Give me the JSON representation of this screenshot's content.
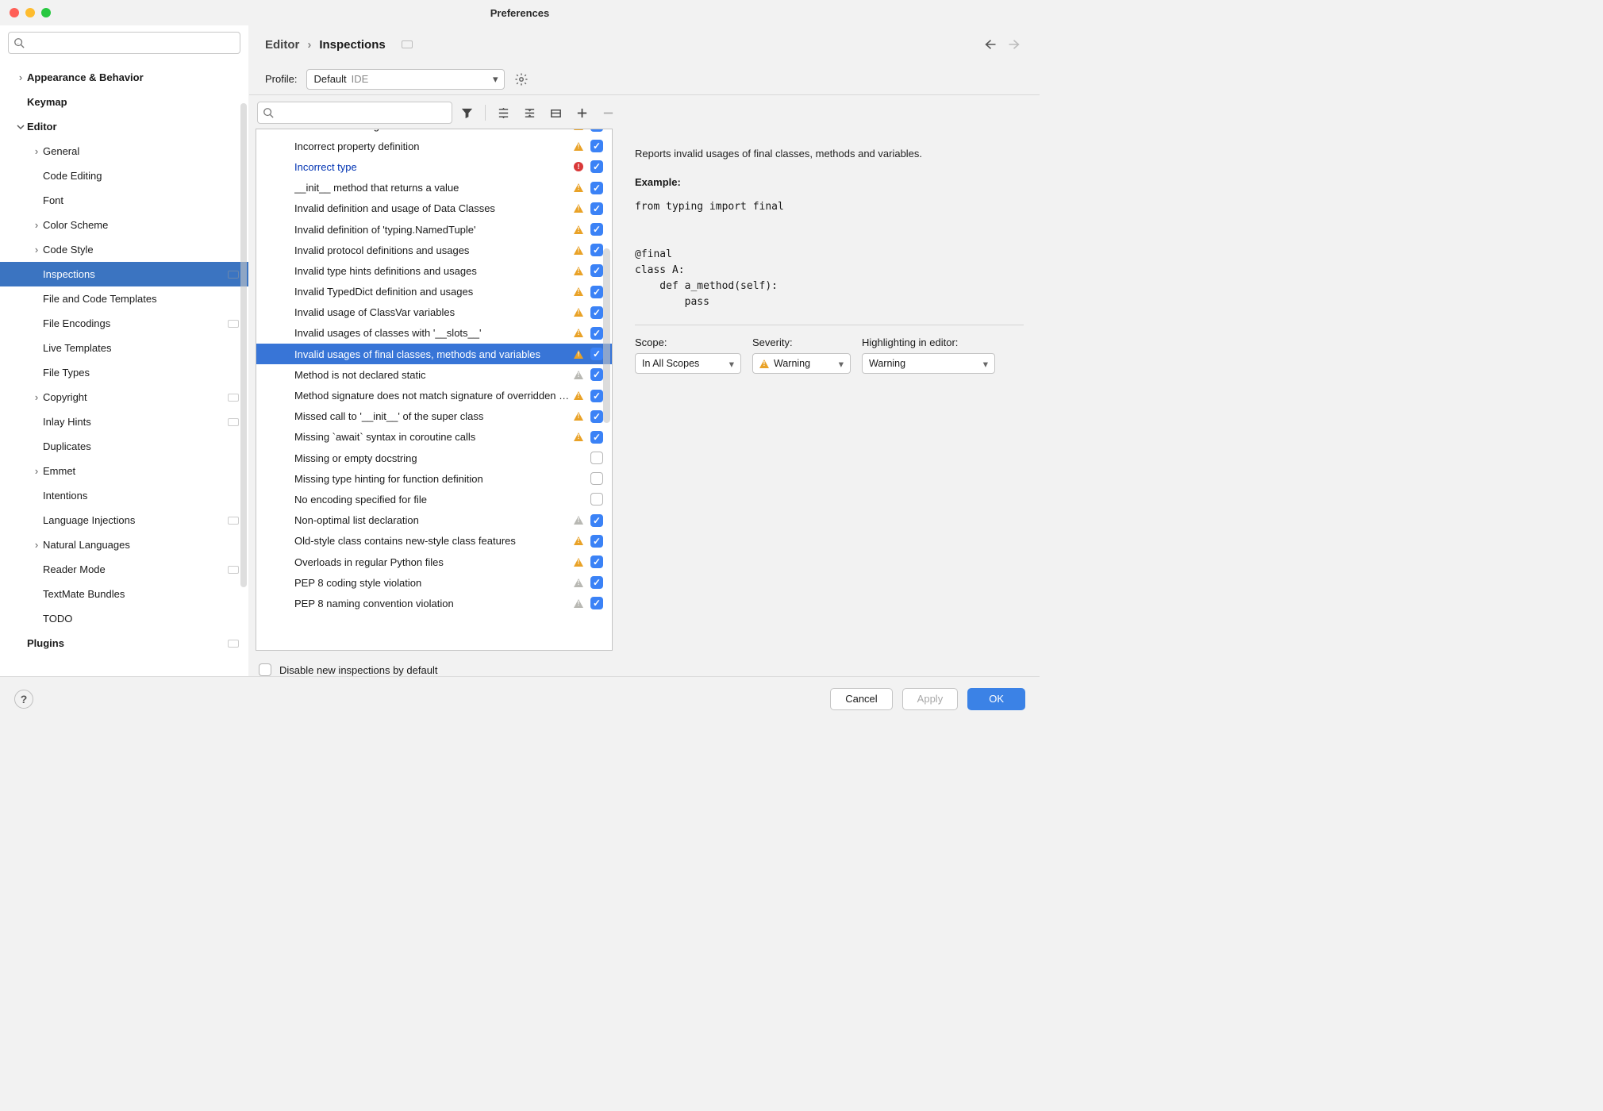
{
  "window": {
    "title": "Preferences"
  },
  "breadcrumb": {
    "parent": "Editor",
    "current": "Inspections"
  },
  "profile": {
    "label": "Profile:",
    "selected": "Default",
    "suffix": "IDE"
  },
  "sidebar": {
    "items": [
      {
        "label": "Appearance & Behavior",
        "level": 0,
        "bold": true,
        "arrow": "right"
      },
      {
        "label": "Keymap",
        "level": 0,
        "bold": true
      },
      {
        "label": "Editor",
        "level": 0,
        "bold": true,
        "arrow": "down"
      },
      {
        "label": "General",
        "level": 1,
        "arrow": "right"
      },
      {
        "label": "Code Editing",
        "level": 1
      },
      {
        "label": "Font",
        "level": 1
      },
      {
        "label": "Color Scheme",
        "level": 1,
        "arrow": "right"
      },
      {
        "label": "Code Style",
        "level": 1,
        "arrow": "right"
      },
      {
        "label": "Inspections",
        "level": 1,
        "selected": true,
        "badge": true
      },
      {
        "label": "File and Code Templates",
        "level": 1
      },
      {
        "label": "File Encodings",
        "level": 1,
        "badge": true
      },
      {
        "label": "Live Templates",
        "level": 1
      },
      {
        "label": "File Types",
        "level": 1
      },
      {
        "label": "Copyright",
        "level": 1,
        "arrow": "right",
        "badge": true
      },
      {
        "label": "Inlay Hints",
        "level": 1,
        "badge": true
      },
      {
        "label": "Duplicates",
        "level": 1
      },
      {
        "label": "Emmet",
        "level": 1,
        "arrow": "right"
      },
      {
        "label": "Intentions",
        "level": 1
      },
      {
        "label": "Language Injections",
        "level": 1,
        "badge": true
      },
      {
        "label": "Natural Languages",
        "level": 1,
        "arrow": "right"
      },
      {
        "label": "Reader Mode",
        "level": 1,
        "badge": true
      },
      {
        "label": "TextMate Bundles",
        "level": 1
      },
      {
        "label": "TODO",
        "level": 1
      },
      {
        "label": "Plugins",
        "level": 0,
        "bold": true,
        "badge": true
      }
    ]
  },
  "inspections": [
    {
      "label": "Incorrect docstring",
      "sev": "warn",
      "checked": true,
      "partial": true
    },
    {
      "label": "Incorrect property definition",
      "sev": "warn",
      "checked": true
    },
    {
      "label": "Incorrect type",
      "sev": "error",
      "checked": true,
      "linked": true
    },
    {
      "label": "__init__ method that returns a value",
      "sev": "warn",
      "checked": true
    },
    {
      "label": "Invalid definition and usage of Data Classes",
      "sev": "warn",
      "checked": true
    },
    {
      "label": "Invalid definition of 'typing.NamedTuple'",
      "sev": "warn",
      "checked": true
    },
    {
      "label": "Invalid protocol definitions and usages",
      "sev": "warn",
      "checked": true
    },
    {
      "label": "Invalid type hints definitions and usages",
      "sev": "warn",
      "checked": true
    },
    {
      "label": "Invalid TypedDict definition and usages",
      "sev": "warn",
      "checked": true
    },
    {
      "label": "Invalid usage of ClassVar variables",
      "sev": "warn",
      "checked": true
    },
    {
      "label": "Invalid usages of classes with '__slots__'",
      "sev": "warn",
      "checked": true
    },
    {
      "label": "Invalid usages of final classes, methods and variables",
      "sev": "warn",
      "checked": true,
      "selected": true
    },
    {
      "label": "Method is not declared static",
      "sev": "warn-gray",
      "checked": true
    },
    {
      "label": "Method signature does not match signature of overridden method",
      "sev": "warn",
      "checked": true
    },
    {
      "label": "Missed call to '__init__' of the super class",
      "sev": "warn",
      "checked": true
    },
    {
      "label": "Missing `await` syntax in coroutine calls",
      "sev": "warn",
      "checked": true
    },
    {
      "label": "Missing or empty docstring",
      "sev": "",
      "checked": false
    },
    {
      "label": "Missing type hinting for function definition",
      "sev": "",
      "checked": false
    },
    {
      "label": "No encoding specified for file",
      "sev": "",
      "checked": false
    },
    {
      "label": "Non-optimal list declaration",
      "sev": "warn-gray",
      "checked": true
    },
    {
      "label": "Old-style class contains new-style class features",
      "sev": "warn",
      "checked": true
    },
    {
      "label": "Overloads in regular Python files",
      "sev": "warn",
      "checked": true
    },
    {
      "label": "PEP 8 coding style violation",
      "sev": "warn-gray",
      "checked": true
    },
    {
      "label": "PEP 8 naming convention violation",
      "sev": "warn-gray",
      "checked": true,
      "partial_bottom": true
    }
  ],
  "detail": {
    "description": "Reports invalid usages of final classes, methods and variables.",
    "example_label": "Example:",
    "code": "from typing import final\n\n\n@final\nclass A:\n    def a_method(self):\n        pass",
    "scope_label": "Scope:",
    "scope_value": "In All Scopes",
    "severity_label": "Severity:",
    "severity_value": "Warning",
    "highlight_label": "Highlighting in editor:",
    "highlight_value": "Warning"
  },
  "disable_label": "Disable new inspections by default",
  "footer": {
    "cancel": "Cancel",
    "apply": "Apply",
    "ok": "OK"
  }
}
